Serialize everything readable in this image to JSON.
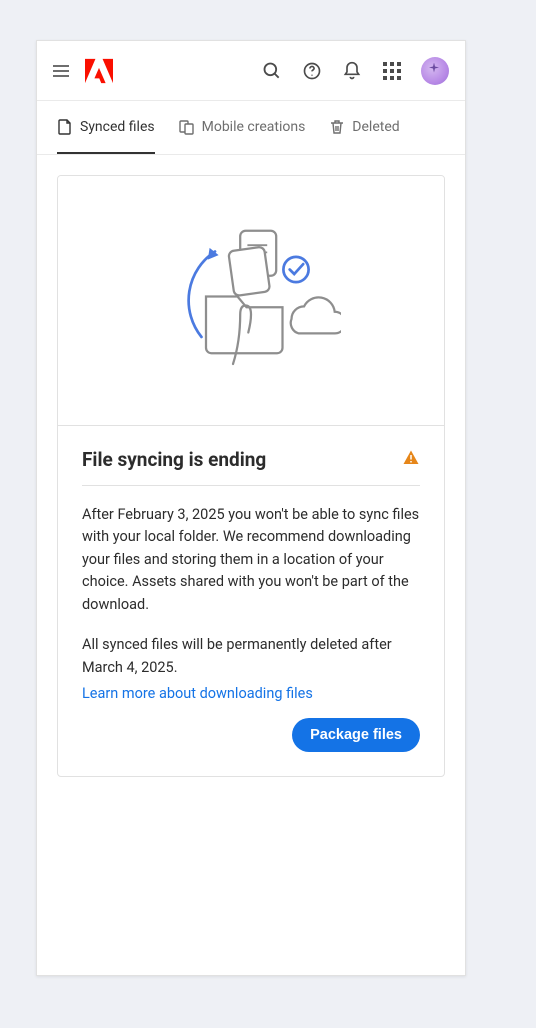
{
  "header": {
    "icons": {
      "menu": "menu",
      "search": "search",
      "help": "help",
      "notifications": "notifications",
      "apps": "apps"
    }
  },
  "tabs": {
    "synced": "Synced files",
    "mobile": "Mobile creations",
    "deleted": "Deleted"
  },
  "card": {
    "title": "File syncing is ending",
    "paragraph1": "After February 3, 2025 you won't be able to sync files with your local folder. We recommend downloading your files and storing them in a location of your choice. Assets shared with you won't be part of the download.",
    "paragraph2": "All synced files will be permanently deleted after March 4, 2025.",
    "learn_more": "Learn more about downloading files",
    "action": "Package files"
  }
}
